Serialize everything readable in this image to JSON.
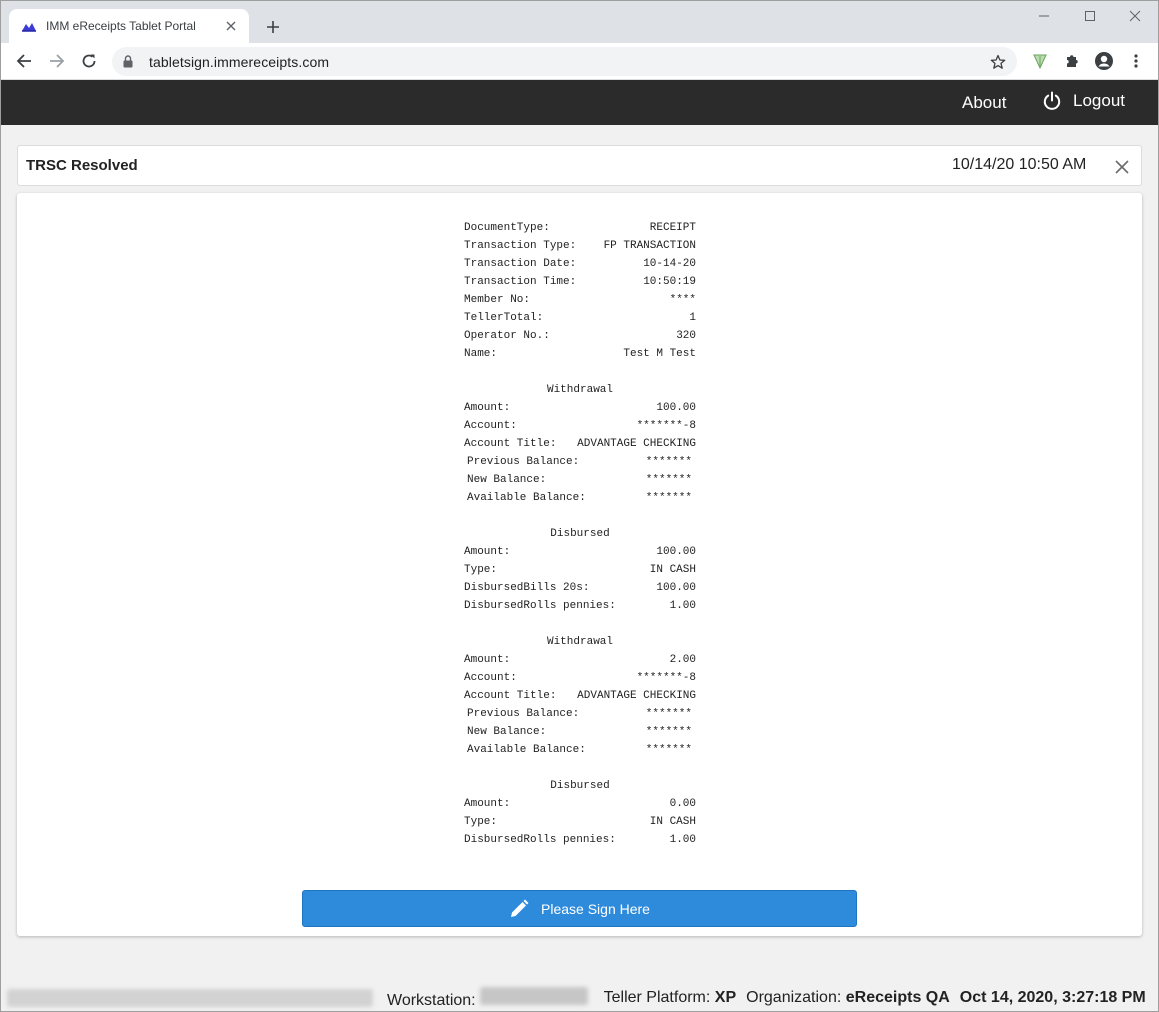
{
  "browser": {
    "tab_title": "IMM eReceipts Tablet Portal",
    "url": "tabletsign.immereceipts.com"
  },
  "navbar": {
    "about_label": "About",
    "logout_label": "Logout"
  },
  "document": {
    "title": "TRSC Resolved",
    "datetime": "10/14/20 10:50 AM"
  },
  "receipt": {
    "header": [
      {
        "label": "DocumentType:",
        "value": "RECEIPT"
      },
      {
        "label": "Transaction Type:",
        "value": "FP TRANSACTION"
      },
      {
        "label": "Transaction Date:",
        "value": "10-14-20"
      },
      {
        "label": "Transaction Time:",
        "value": "10:50:19"
      },
      {
        "label": "Member No:",
        "value": "****"
      },
      {
        "label": "TellerTotal:",
        "value": "1"
      },
      {
        "label": "Operator No.:",
        "value": "320"
      },
      {
        "label": "Name:",
        "value": "Test M Test"
      }
    ],
    "withdrawal1": {
      "heading": "Withdrawal",
      "amount": {
        "label": "Amount:",
        "value": "100.00"
      },
      "account": {
        "label": "Account:",
        "value": "*******-8"
      },
      "account_title": {
        "label": "Account Title:",
        "value": "ADVANTAGE CHECKING"
      },
      "previous_balance": {
        "label": "Previous Balance:",
        "value": "*******"
      },
      "new_balance": {
        "label": "New Balance:",
        "value": "*******"
      },
      "available_balance": {
        "label": "Available Balance:",
        "value": "*******"
      }
    },
    "disbursed1": {
      "heading": "Disbursed",
      "amount": {
        "label": "Amount:",
        "value": "100.00"
      },
      "type": {
        "label": "Type:",
        "value": "IN CASH"
      },
      "bills": {
        "label": "DisbursedBills 20s:",
        "value": "100.00"
      },
      "rolls": {
        "label": "DisbursedRolls pennies:",
        "value": "1.00"
      }
    },
    "withdrawal2": {
      "heading": "Withdrawal",
      "amount": {
        "label": "Amount:",
        "value": "2.00"
      },
      "account": {
        "label": "Account:",
        "value": "*******-8"
      },
      "account_title": {
        "label": "Account Title:",
        "value": "ADVANTAGE CHECKING"
      },
      "previous_balance": {
        "label": "Previous Balance:",
        "value": "*******"
      },
      "new_balance": {
        "label": "New Balance:",
        "value": "*******"
      },
      "available_balance": {
        "label": "Available Balance:",
        "value": "*******"
      }
    },
    "disbursed2": {
      "heading": "Disbursed",
      "amount": {
        "label": "Amount:",
        "value": "0.00"
      },
      "type": {
        "label": "Type:",
        "value": "IN CASH"
      },
      "rolls": {
        "label": "DisbursedRolls pennies:",
        "value": "1.00"
      }
    }
  },
  "sign_button_label": "Please Sign Here",
  "statusbar": {
    "workstation_label": "Workstation:",
    "teller_platform_label": "Teller Platform:",
    "teller_platform_value": "XP",
    "organization_label": "Organization:",
    "organization_value": "eReceipts QA",
    "timestamp": "Oct 14, 2020, 3:27:18 PM"
  },
  "colors": {
    "navbar": "#2b2b2b",
    "sign_button": "#2e8bdb",
    "page_background": "#f1f1f1"
  }
}
